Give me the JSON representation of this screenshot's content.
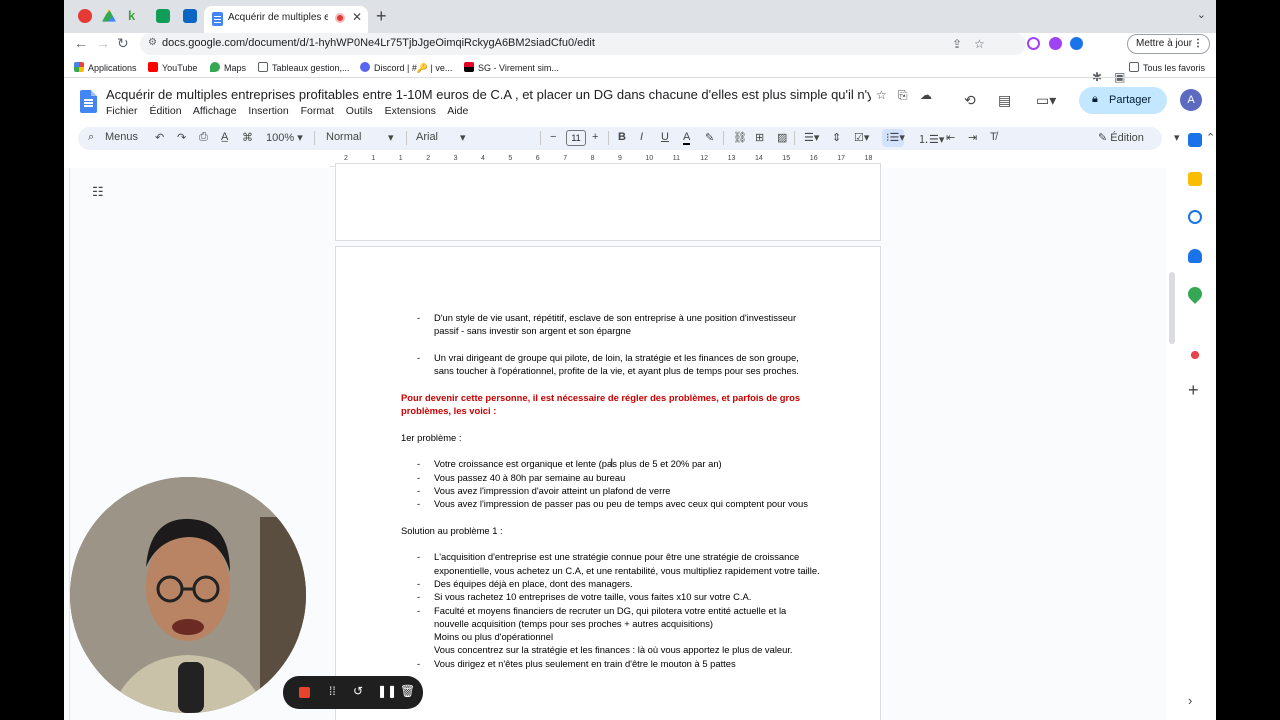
{
  "browser": {
    "active_tab_title": "Acquérir de multiples entreprises",
    "url": "docs.google.com/document/d/1-hyhWP0Ne4Lr75TjbJgeOimqiRckygA6BM2siadCfu0/edit",
    "update_button": "Mettre à jour",
    "bookmarks": [
      "Applications",
      "YouTube",
      "Maps",
      "Tableaux gestion,...",
      "Discord | #🔑 | ve...",
      "SG - Virement sim..."
    ],
    "all_bookmarks": "Tous les favoris"
  },
  "docs": {
    "title": "Acquérir de multiples entreprises profitables entre 1-10M euros de C.A , et placer un DG dans chacune d'elles est plus simple qu'il n'y pa...",
    "menu": [
      "Fichier",
      "Édition",
      "Affichage",
      "Insertion",
      "Format",
      "Outils",
      "Extensions",
      "Aide"
    ],
    "share_label": "Partager",
    "avatar_initial": "A",
    "toolbar": {
      "menus_label": "Menus",
      "zoom": "100%",
      "style": "Normal",
      "font": "Arial",
      "font_size": "11",
      "mode": "Édition"
    },
    "ruler_labels": [
      "2",
      "1",
      "1",
      "2",
      "3",
      "4",
      "5",
      "6",
      "7",
      "8",
      "9",
      "10",
      "11",
      "12",
      "13",
      "14",
      "15",
      "16",
      "17",
      "18"
    ]
  },
  "document": {
    "bullet1": "D'un style de vie usant, répétitif, esclave de son entreprise à une position d'investisseur passif - sans investir son argent et son épargne",
    "bullet2": "Un vrai dirigeant de groupe qui pilote, de loin, la stratégie et les finances de son groupe, sans toucher à l'opérationnel, profite de la vie, et ayant plus de temps pour ses proches.",
    "red_heading": "Pour devenir cette personne, il est nécessaire de régler des problèmes, et parfois de gros problèmes, les voici :",
    "problem1_title": "1er problème :",
    "problem1_items": [
      "Votre croissance est organique et lente (pas plus de 5 et 20% par an)",
      "Vous passez 40 à 80h par semaine au bureau",
      "Vous avez l'impression d'avoir atteint un plafond de verre",
      "Vous avez l'impression de passer pas ou peu de temps avec ceux qui comptent pour vous"
    ],
    "solution1_title": "Solution au problème 1 :",
    "solution1_items": [
      "L'acquisition d'entreprise est une stratégie connue pour être une stratégie de croissance exponentielle, vous achetez un C.A, et une rentabilité, vous multipliez rapidement votre taille.",
      "Des équipes déjà en place, dont des managers.",
      "Si vous rachetez 10 entreprises de votre taille, vous faites x10 sur votre C.A.",
      "Faculté et moyens financiers de recruter un DG, qui pilotera votre entité actuelle et la nouvelle acquisition (temps pour ses proches + autres acquisitions)"
    ],
    "solution1_extra": [
      "Moins ou plus d'opérationnel",
      "Vous concentrez sur la stratégie et les finances : là où vous apportez le plus de valeur."
    ],
    "last_item": "Vous dirigez et n'êtes plus seulement en train d'être le mouton à 5 pattes"
  },
  "colors": {
    "accent": "#c2e7ff",
    "heading_red": "#cc0000",
    "toolbar_bg": "#edf2fa"
  }
}
